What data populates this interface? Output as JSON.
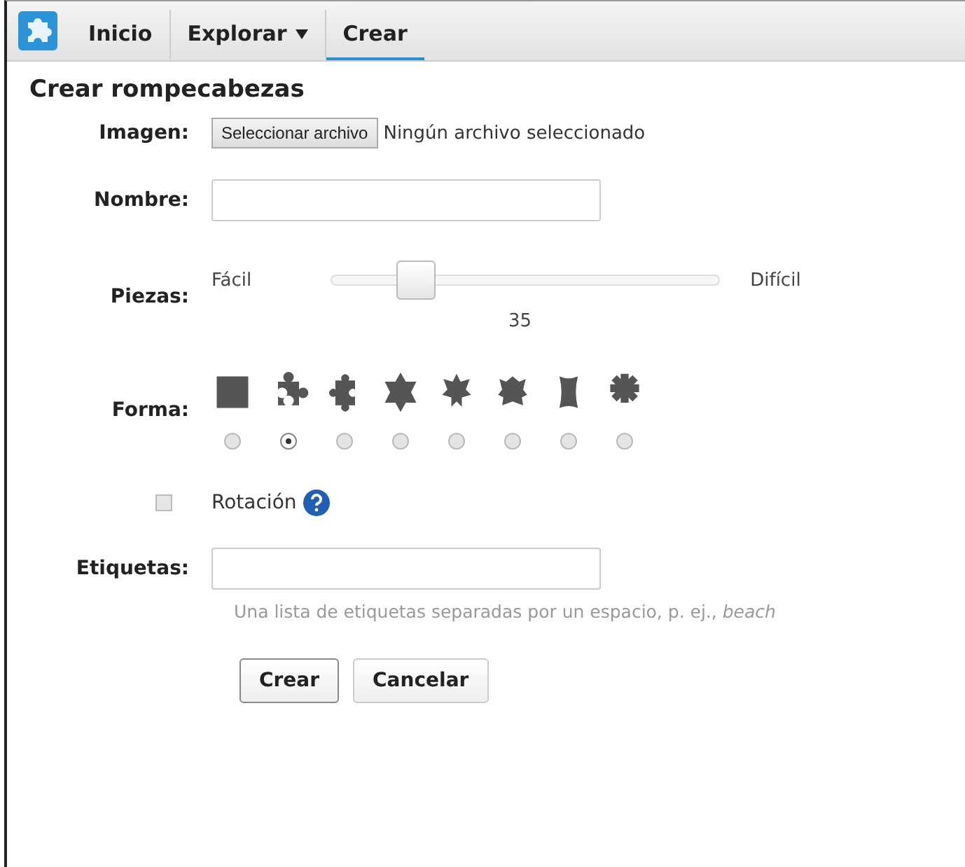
{
  "nav": {
    "items": [
      {
        "label": "Inicio",
        "selected": false,
        "dropdown": false
      },
      {
        "label": "Explorar",
        "selected": false,
        "dropdown": true
      },
      {
        "label": "Crear",
        "selected": true,
        "dropdown": false
      }
    ]
  },
  "form": {
    "title": "Crear rompecabezas",
    "image": {
      "label": "Imagen:",
      "button": "Seleccionar archivo",
      "status": "Ningún archivo seleccionado"
    },
    "name": {
      "label": "Nombre:"
    },
    "pieces": {
      "label": "Piezas:",
      "min_label": "Fácil",
      "max_label": "Difícil",
      "level": 0.22,
      "value": "35"
    },
    "shape": {
      "label": "Forma:",
      "options": [
        {
          "kind": "square",
          "selected": false
        },
        {
          "kind": "classic",
          "selected": true
        },
        {
          "kind": "knob",
          "selected": false
        },
        {
          "kind": "star",
          "selected": false
        },
        {
          "kind": "spiky",
          "selected": false
        },
        {
          "kind": "notch",
          "selected": false
        },
        {
          "kind": "barrel",
          "selected": false
        },
        {
          "kind": "gear",
          "selected": false
        }
      ]
    },
    "rotation": {
      "label": "Rotación",
      "checked": false
    },
    "tags": {
      "label": "Etiquetas:",
      "hint": "Una lista de etiquetas separadas por un espacio, p. ej., *beach*"
    },
    "buttons": [
      "Crear",
      "Cancelar"
    ]
  }
}
